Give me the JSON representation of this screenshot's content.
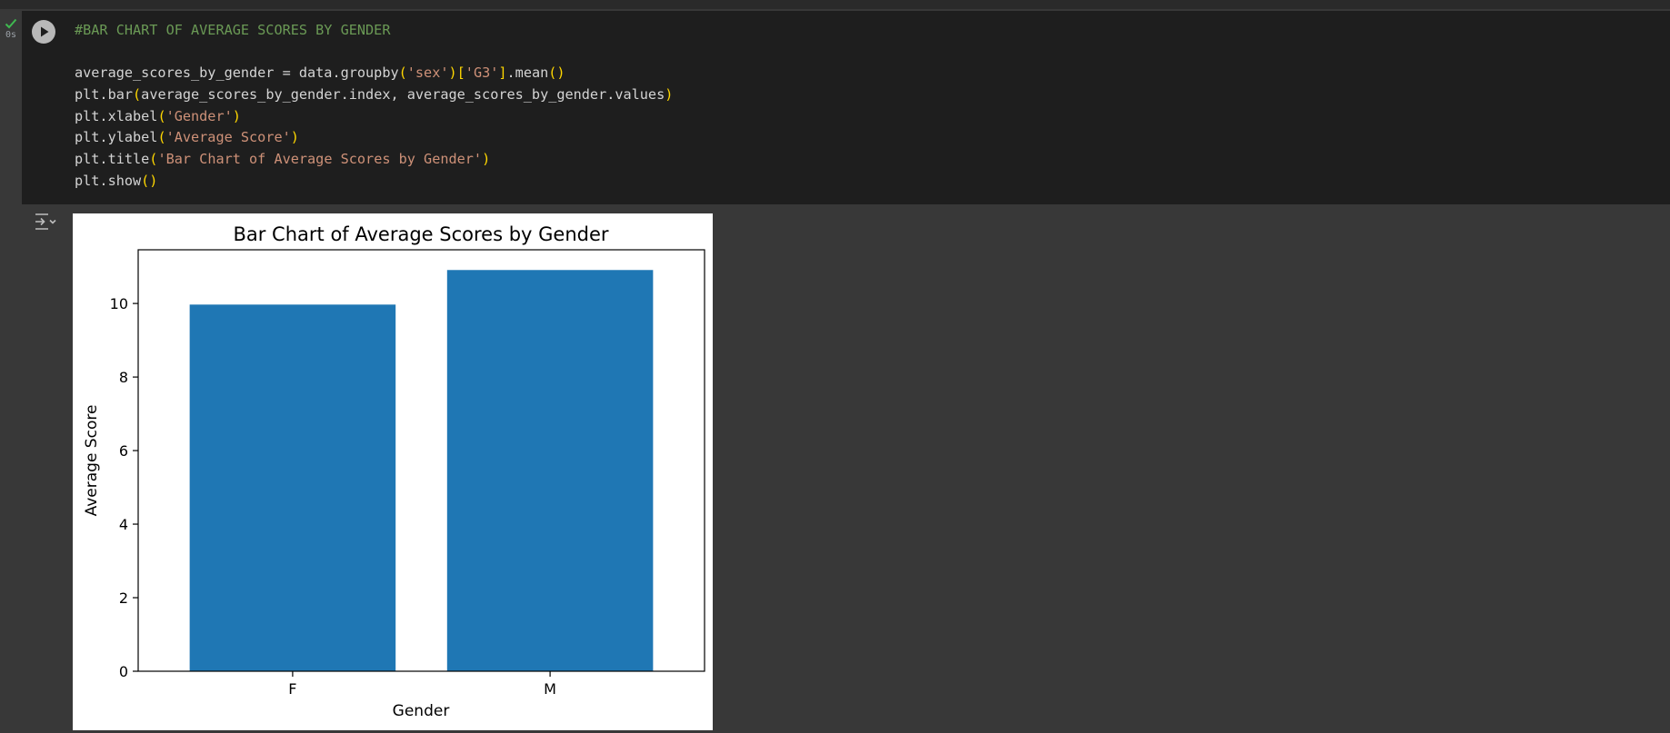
{
  "cell": {
    "status_time": "0s",
    "code_comment": "#BAR CHART OF AVERAGE SCORES BY GENDER",
    "code_lines": [
      [
        [
          "t",
          "average_scores_by_gender = data.groupby"
        ],
        [
          "b",
          "("
        ],
        [
          "s",
          "'sex'"
        ],
        [
          "b",
          ")"
        ],
        [
          "b",
          "["
        ],
        [
          "s",
          "'G3'"
        ],
        [
          "b",
          "]"
        ],
        [
          "t",
          ".mean"
        ],
        [
          "b",
          "()"
        ]
      ],
      [
        [
          "t",
          "plt.bar"
        ],
        [
          "b",
          "("
        ],
        [
          "t",
          "average_scores_by_gender.index, average_scores_by_gender.values"
        ],
        [
          "b",
          ")"
        ]
      ],
      [
        [
          "t",
          "plt.xlabel"
        ],
        [
          "b",
          "("
        ],
        [
          "s",
          "'Gender'"
        ],
        [
          "b",
          ")"
        ]
      ],
      [
        [
          "t",
          "plt.ylabel"
        ],
        [
          "b",
          "("
        ],
        [
          "s",
          "'Average Score'"
        ],
        [
          "b",
          ")"
        ]
      ],
      [
        [
          "t",
          "plt.title"
        ],
        [
          "b",
          "("
        ],
        [
          "s",
          "'Bar Chart of Average Scores by Gender'"
        ],
        [
          "b",
          ")"
        ]
      ],
      [
        [
          "t",
          "plt.show"
        ],
        [
          "b",
          "()"
        ]
      ]
    ]
  },
  "colors": {
    "bar": "#1f77b4",
    "check": "#3fb950"
  },
  "icons": {
    "status": "check-icon",
    "run": "play-icon",
    "output": "output-toggle-icon"
  },
  "chart_data": {
    "type": "bar",
    "title": "Bar Chart of Average Scores by Gender",
    "xlabel": "Gender",
    "ylabel": "Average Score",
    "categories": [
      "F",
      "M"
    ],
    "values": [
      9.97,
      10.91
    ],
    "ylim": [
      0,
      11.46
    ],
    "yticks": [
      0,
      2,
      4,
      6,
      8,
      10
    ],
    "grid": false
  }
}
